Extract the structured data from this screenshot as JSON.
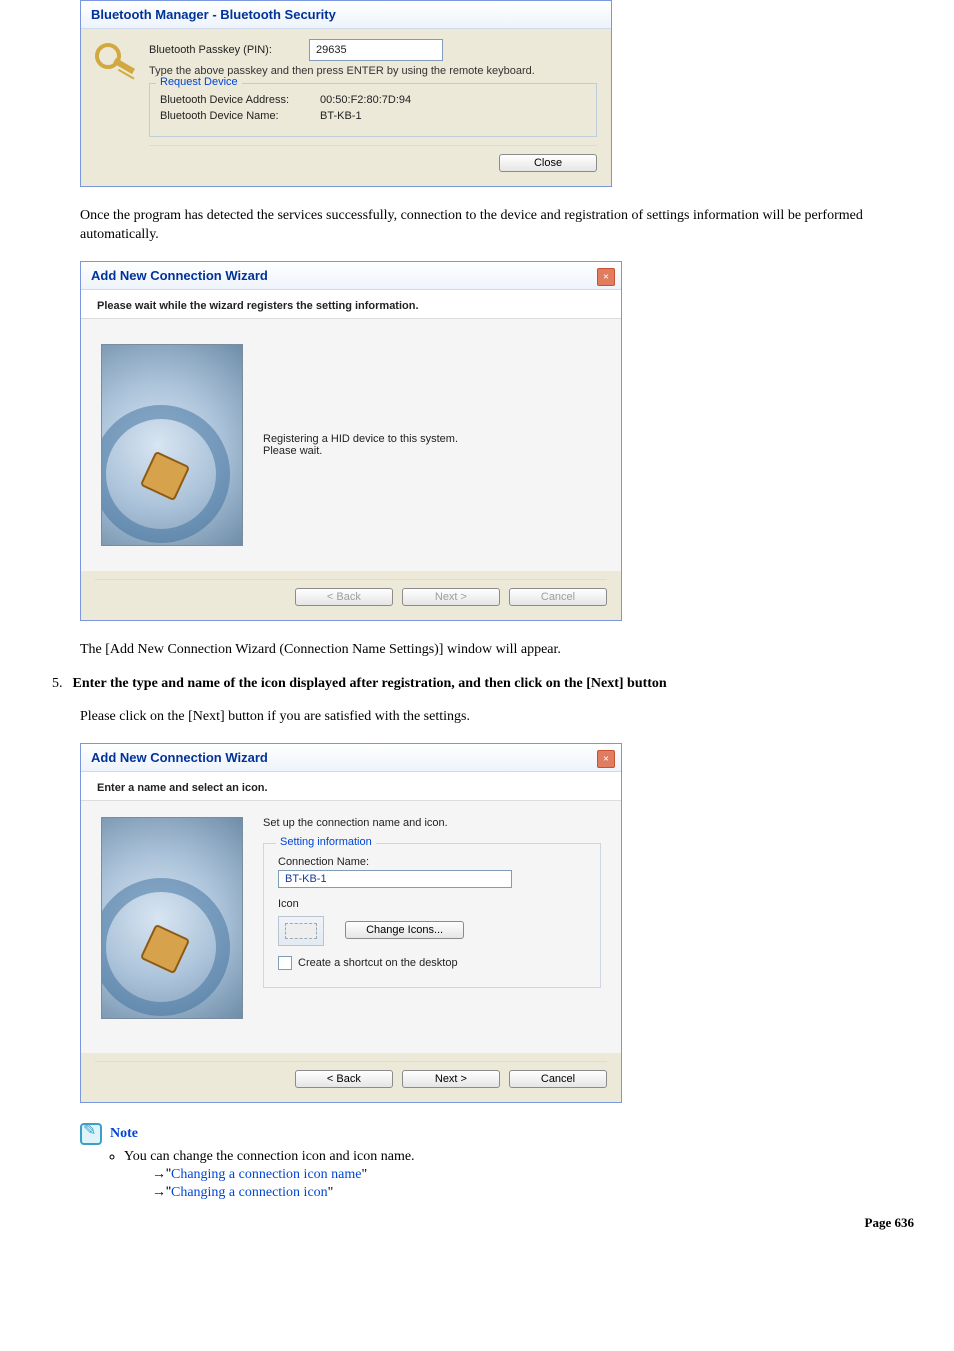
{
  "panel1": {
    "title": "Bluetooth Manager - Bluetooth Security",
    "passkey_label": "Bluetooth Passkey (PIN):",
    "passkey_value": "29635",
    "hint": "Type the above passkey and then press ENTER by using the remote keyboard.",
    "fieldset_legend": "Request Device",
    "addr_label": "Bluetooth Device Address:",
    "addr_value": "00:50:F2:80:7D:94",
    "name_label": "Bluetooth Device Name:",
    "name_value": "BT-KB-1",
    "close_btn": "Close"
  },
  "para1": "Once the program has detected the services successfully, connection to the device and registration of settings information will be performed automatically.",
  "panel2": {
    "title": "Add New Connection Wizard",
    "instruction": "Please wait while the wizard registers the setting information.",
    "msg_line1": "Registering a HID device to this system.",
    "msg_line2": "Please wait.",
    "back_btn": "< Back",
    "next_btn": "Next >",
    "cancel_btn": "Cancel"
  },
  "para2": "The [Add New Connection Wizard (Connection Name Settings)] window will appear.",
  "step5_number": "5.",
  "step5_head": "Enter the type and name of the icon displayed after registration, and then click on the [Next] button",
  "step5_body": "Please click on the [Next] button if you are satisfied with the settings.",
  "panel3": {
    "title": "Add New Connection Wizard",
    "instruction": "Enter a name and select an icon.",
    "intro": "Set up the connection name and icon.",
    "fieldset_legend": "Setting information",
    "conn_name_label": "Connection Name:",
    "conn_name_value": "BT-KB-1",
    "icon_label": "Icon",
    "change_icons_btn": "Change Icons...",
    "shortcut_label": "Create a shortcut on the desktop",
    "back_btn": "< Back",
    "next_btn": "Next >",
    "cancel_btn": "Cancel"
  },
  "note": {
    "label": "Note",
    "line1": "You can change the connection icon and icon name.",
    "link1": "Changing a connection icon name",
    "link2": "Changing a connection icon",
    "arrow": "→\"",
    "quote_end": "\""
  },
  "footer": "Page 636"
}
